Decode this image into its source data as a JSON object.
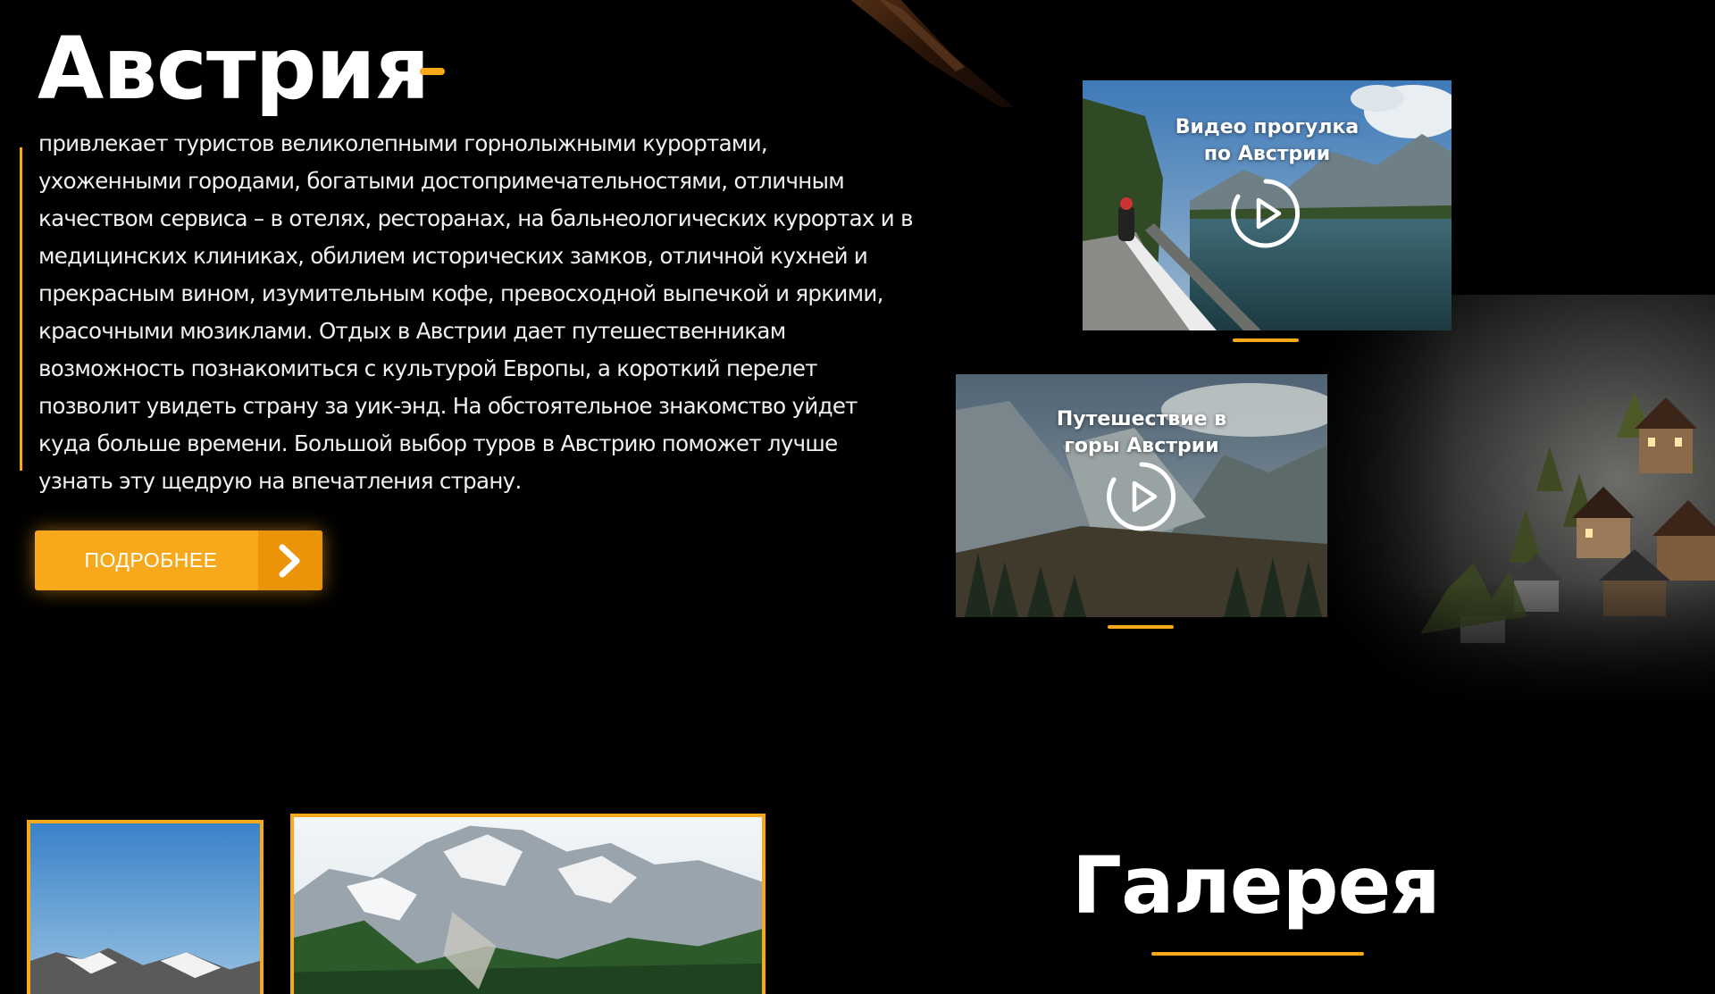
{
  "hero": {
    "title": "Австрия",
    "description": "привлекает туристов великолепными горнолыжными курортами, ухоженными городами, богатыми достопримечательностями, отличным качеством сервиса – в отелях, ресторанах, на бальнеологических курортах и в медицинских клиниках, обилием исторических замков, отличной кухней и прекрасным вином, изумительным кофе, превосходной выпечкой и яркими, красочными мюзиклами. Отдых в Австрии дает путешественникам возможность познакомиться с культурой Европы, а короткий перелет позволит увидеть страну за уик-энд. На обстоятельное знакомство уйдет куда больше времени. Большой выбор туров в Австрию поможет лучше узнать эту щедрую на впечатления страну.",
    "button_label": "ПОДРОБНЕЕ",
    "button_icon": "chevron-right-icon"
  },
  "videos": [
    {
      "title_line1": "Видео прогулка",
      "title_line2": "по Австрии",
      "icon": "play-icon"
    },
    {
      "title_line1": "Путешествие в",
      "title_line2": "горы Австрии",
      "icon": "play-icon"
    }
  ],
  "gallery": {
    "title": "Галерея"
  },
  "colors": {
    "accent": "#f7a81b",
    "background": "#000000",
    "text": "#ffffff"
  }
}
